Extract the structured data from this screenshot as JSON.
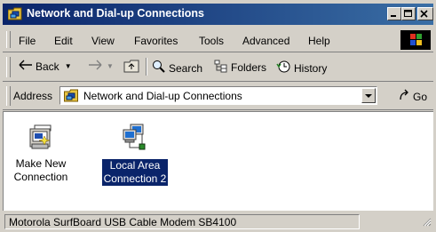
{
  "window": {
    "title": "Network and Dial-up Connections",
    "title_icon": "network-folder-icon"
  },
  "menubar": {
    "items": [
      "File",
      "Edit",
      "View",
      "Favorites",
      "Tools",
      "Advanced",
      "Help"
    ]
  },
  "toolbar": {
    "back_label": "Back",
    "search_label": "Search",
    "folders_label": "Folders",
    "history_label": "History"
  },
  "address": {
    "label": "Address",
    "value": "Network and Dial-up Connections",
    "go_label": "Go"
  },
  "items": [
    {
      "label": "Make New\nConnection",
      "icon": "make-new-connection-icon",
      "selected": false
    },
    {
      "label": "Local Area\nConnection 2",
      "icon": "local-area-connection-icon",
      "selected": true
    }
  ],
  "status": {
    "text": "Motorola SurfBoard USB Cable Modem SB4100"
  },
  "colors": {
    "title_bar_start": "#0a246a",
    "title_bar_end": "#3a6ea5",
    "selection": "#0a246a",
    "chrome": "#d4d0c8"
  }
}
